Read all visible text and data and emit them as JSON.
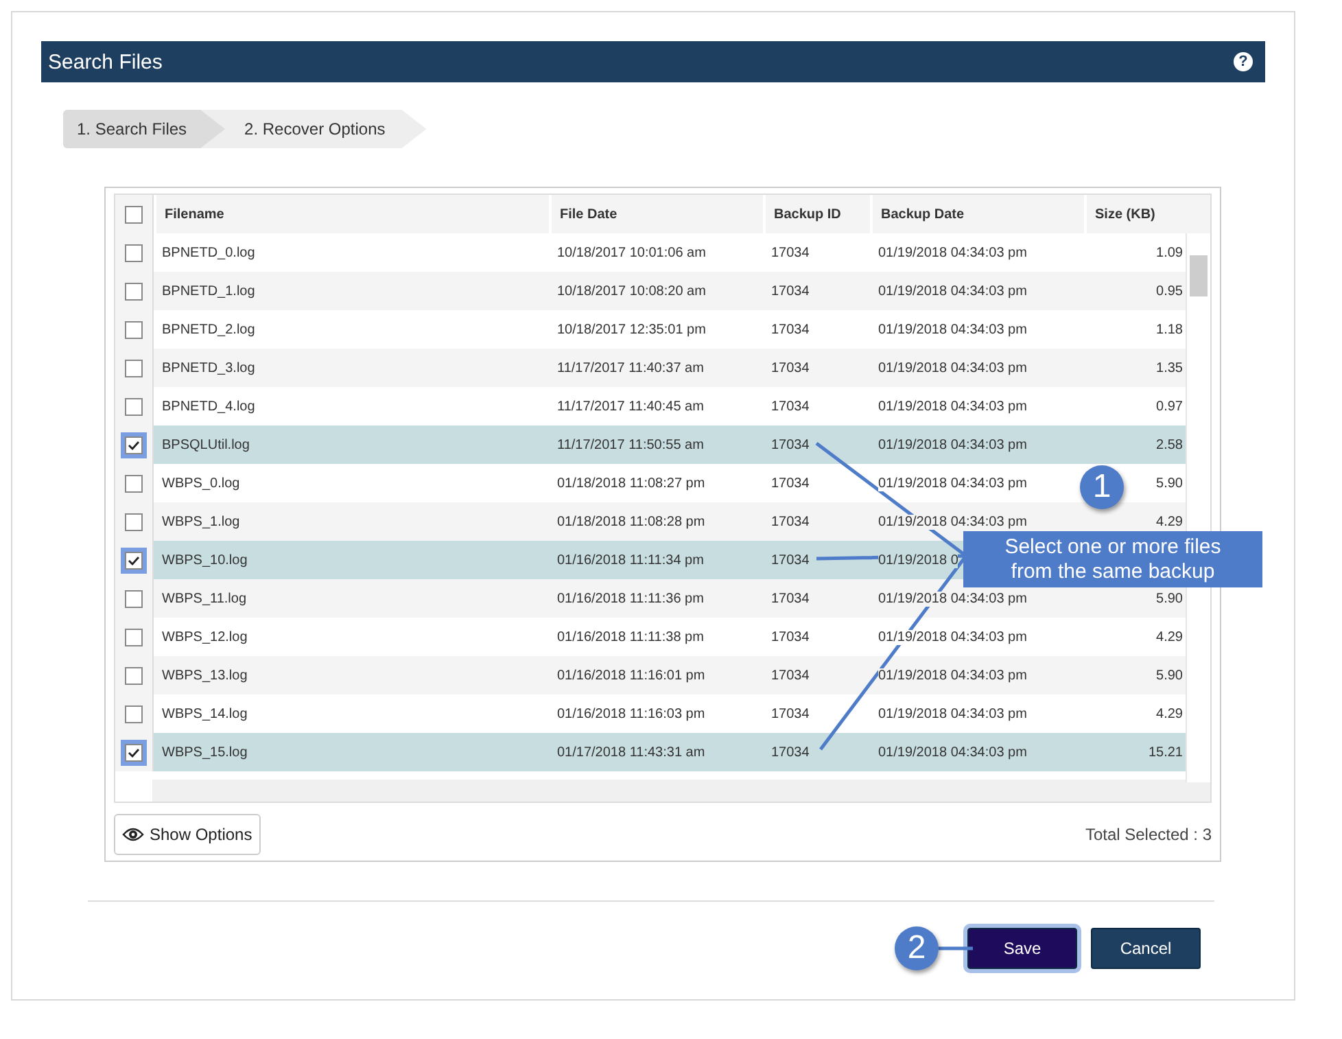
{
  "header": {
    "title": "Search Files",
    "help": "?"
  },
  "steps": [
    {
      "label": "1. Search Files",
      "selected": true
    },
    {
      "label": "2. Recover Options",
      "selected": false
    }
  ],
  "table": {
    "select_all": false,
    "columns": [
      "Filename",
      "File Date",
      "Backup ID",
      "Backup Date",
      "Size (KB)"
    ],
    "rows": [
      {
        "checked": false,
        "cells": [
          "BPNETD_0.log",
          "10/18/2017 10:01:06 am",
          "17034",
          "01/19/2018 04:34:03 pm",
          "1.09"
        ]
      },
      {
        "checked": false,
        "cells": [
          "BPNETD_1.log",
          "10/18/2017 10:08:20 am",
          "17034",
          "01/19/2018 04:34:03 pm",
          "0.95"
        ]
      },
      {
        "checked": false,
        "cells": [
          "BPNETD_2.log",
          "10/18/2017 12:35:01 pm",
          "17034",
          "01/19/2018 04:34:03 pm",
          "1.18"
        ]
      },
      {
        "checked": false,
        "cells": [
          "BPNETD_3.log",
          "11/17/2017 11:40:37 am",
          "17034",
          "01/19/2018 04:34:03 pm",
          "1.35"
        ]
      },
      {
        "checked": false,
        "cells": [
          "BPNETD_4.log",
          "11/17/2017 11:40:45 am",
          "17034",
          "01/19/2018 04:34:03 pm",
          "0.97"
        ]
      },
      {
        "checked": true,
        "cells": [
          "BPSQLUtil.log",
          "11/17/2017 11:50:55 am",
          "17034",
          "01/19/2018 04:34:03 pm",
          "2.58"
        ]
      },
      {
        "checked": false,
        "cells": [
          "WBPS_0.log",
          "01/18/2018 11:08:27 pm",
          "17034",
          "01/19/2018 04:34:03 pm",
          "5.90"
        ]
      },
      {
        "checked": false,
        "cells": [
          "WBPS_1.log",
          "01/18/2018 11:08:28 pm",
          "17034",
          "01/19/2018 04:34:03 pm",
          "4.29"
        ]
      },
      {
        "checked": true,
        "cells": [
          "WBPS_10.log",
          "01/16/2018 11:11:34 pm",
          "17034",
          "01/19/2018 0",
          ""
        ]
      },
      {
        "checked": false,
        "cells": [
          "WBPS_11.log",
          "01/16/2018 11:11:36 pm",
          "17034",
          "01/19/2018 04:34:03 pm",
          "5.90"
        ]
      },
      {
        "checked": false,
        "cells": [
          "WBPS_12.log",
          "01/16/2018 11:11:38 pm",
          "17034",
          "01/19/2018 04:34:03 pm",
          "4.29"
        ]
      },
      {
        "checked": false,
        "cells": [
          "WBPS_13.log",
          "01/16/2018 11:16:01 pm",
          "17034",
          "01/19/2018 04:34:03 pm",
          "5.90"
        ]
      },
      {
        "checked": false,
        "cells": [
          "WBPS_14.log",
          "01/16/2018 11:16:03 pm",
          "17034",
          "01/19/2018 04:34:03 pm",
          "4.29"
        ]
      },
      {
        "checked": true,
        "cells": [
          "WBPS_15.log",
          "01/17/2018 11:43:31 am",
          "17034",
          "01/19/2018 04:34:03 pm",
          "15.21"
        ]
      }
    ]
  },
  "show_options": "Show Options",
  "total_selected": "Total Selected : 3",
  "buttons": [
    {
      "label": "Save",
      "kind": "primary"
    },
    {
      "label": "Cancel",
      "kind": "secondary"
    }
  ],
  "callouts": [
    {
      "number": "1",
      "text": "Select one or more files from the same backup"
    },
    {
      "number": "2"
    }
  ]
}
